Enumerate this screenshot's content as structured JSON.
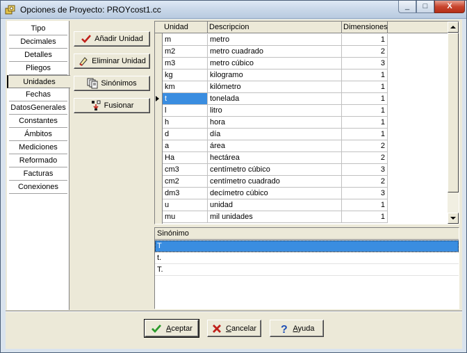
{
  "window": {
    "title": "Opciones de Proyecto: PROYcost1.cc",
    "minimize": "_",
    "maximize": "□",
    "close": "X"
  },
  "tabs": [
    {
      "label": "Tipo"
    },
    {
      "label": "Decimales"
    },
    {
      "label": "Detalles"
    },
    {
      "label": "Pliegos"
    },
    {
      "label": "Unidades",
      "active": true
    },
    {
      "label": "Fechas"
    },
    {
      "label": "DatosGenerales"
    },
    {
      "label": "Constantes"
    },
    {
      "label": "Ámbitos"
    },
    {
      "label": "Mediciones"
    },
    {
      "label": "Reformado"
    },
    {
      "label": "Facturas"
    },
    {
      "label": "Conexiones"
    }
  ],
  "actions": {
    "add": "Añadir Unidad",
    "delete": "Eliminar Unidad",
    "synonyms": "Sinónimos",
    "merge": "Fusionar"
  },
  "grid": {
    "columns": [
      "Unidad",
      "Descripcion",
      "Dimensiones"
    ],
    "rows": [
      [
        "m",
        "metro",
        "1"
      ],
      [
        "m2",
        "metro cuadrado",
        "2"
      ],
      [
        "m3",
        "metro cúbico",
        "3"
      ],
      [
        "kg",
        "kilogramo",
        "1"
      ],
      [
        "km",
        "kilómetro",
        "1"
      ],
      [
        "t",
        "tonelada",
        "1"
      ],
      [
        "l",
        "litro",
        "1"
      ],
      [
        "h",
        "hora",
        "1"
      ],
      [
        "d",
        "día",
        "1"
      ],
      [
        "a",
        "área",
        "2"
      ],
      [
        "Ha",
        "hectárea",
        "2"
      ],
      [
        "cm3",
        "centímetro cúbico",
        "3"
      ],
      [
        "cm2",
        "centímetro cuadrado",
        "2"
      ],
      [
        "dm3",
        "decímetro cúbico",
        "3"
      ],
      [
        "u",
        "unidad",
        "1"
      ],
      [
        "mu",
        "mil unidades",
        "1"
      ]
    ],
    "selected_row": 5
  },
  "synonyms": {
    "header": "Sinónimo",
    "items": [
      "T",
      "t.",
      "T."
    ],
    "selected": 0
  },
  "footer": {
    "accept_pre": "",
    "accept_u": "A",
    "accept_post": "ceptar",
    "cancel_pre": "",
    "cancel_u": "C",
    "cancel_post": "ancelar",
    "help_pre": "",
    "help_u": "A",
    "help_post": "yuda"
  },
  "colors": {
    "selection": "#3a8de0",
    "face": "#ece9d8"
  },
  "icons": {
    "add": "check-icon",
    "delete": "eraser-icon",
    "synonyms": "pages-icon",
    "merge": "merge-icon",
    "accept": "check-icon",
    "cancel": "x-icon",
    "help": "question-icon"
  }
}
